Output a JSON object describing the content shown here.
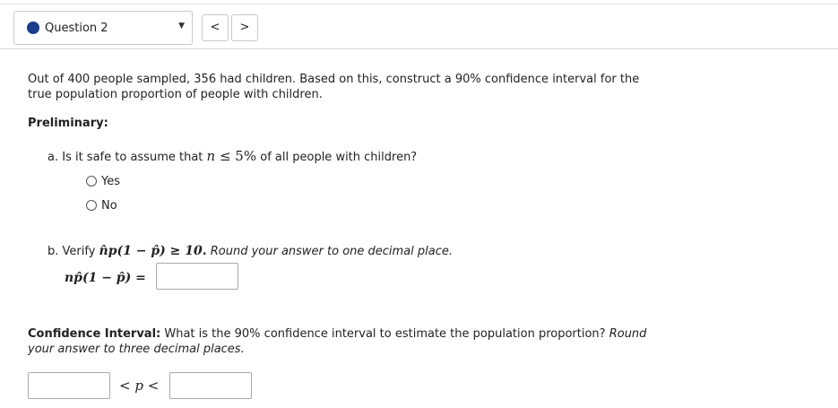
{
  "nav": {
    "question_label": "Question 2",
    "prev_label": "<",
    "next_label": ">"
  },
  "question": {
    "intro_line1": "Out of 400 people sampled, 356 had children. Based on this, construct a 90% confidence interval for the",
    "intro_line2": "true population proportion of people with children.",
    "preliminary_heading": "Preliminary:",
    "part_a": {
      "prefix": "a. Is it safe to assume that ",
      "math_n": "n",
      "math_rel": " ≤ 5",
      "math_pct": "%",
      "suffix": " of all people with children?",
      "options": [
        "Yes",
        "No"
      ]
    },
    "part_b": {
      "prefix": "b. Verify ",
      "expr": "n̂p(1 − p̂) ≥ 10.",
      "instruction": " Round your answer to one decimal place.",
      "input_label": "np̂(1 − p̂) ="
    },
    "ci": {
      "heading": "Confidence Interval:",
      "text_line1": " What is the 90% confidence interval to estimate the population proportion? ",
      "round_word": "Round",
      "text_line2": "your answer to three decimal places.",
      "between_label": "< p <"
    }
  },
  "colors": {
    "accent_dot": "#1c3c8c"
  }
}
